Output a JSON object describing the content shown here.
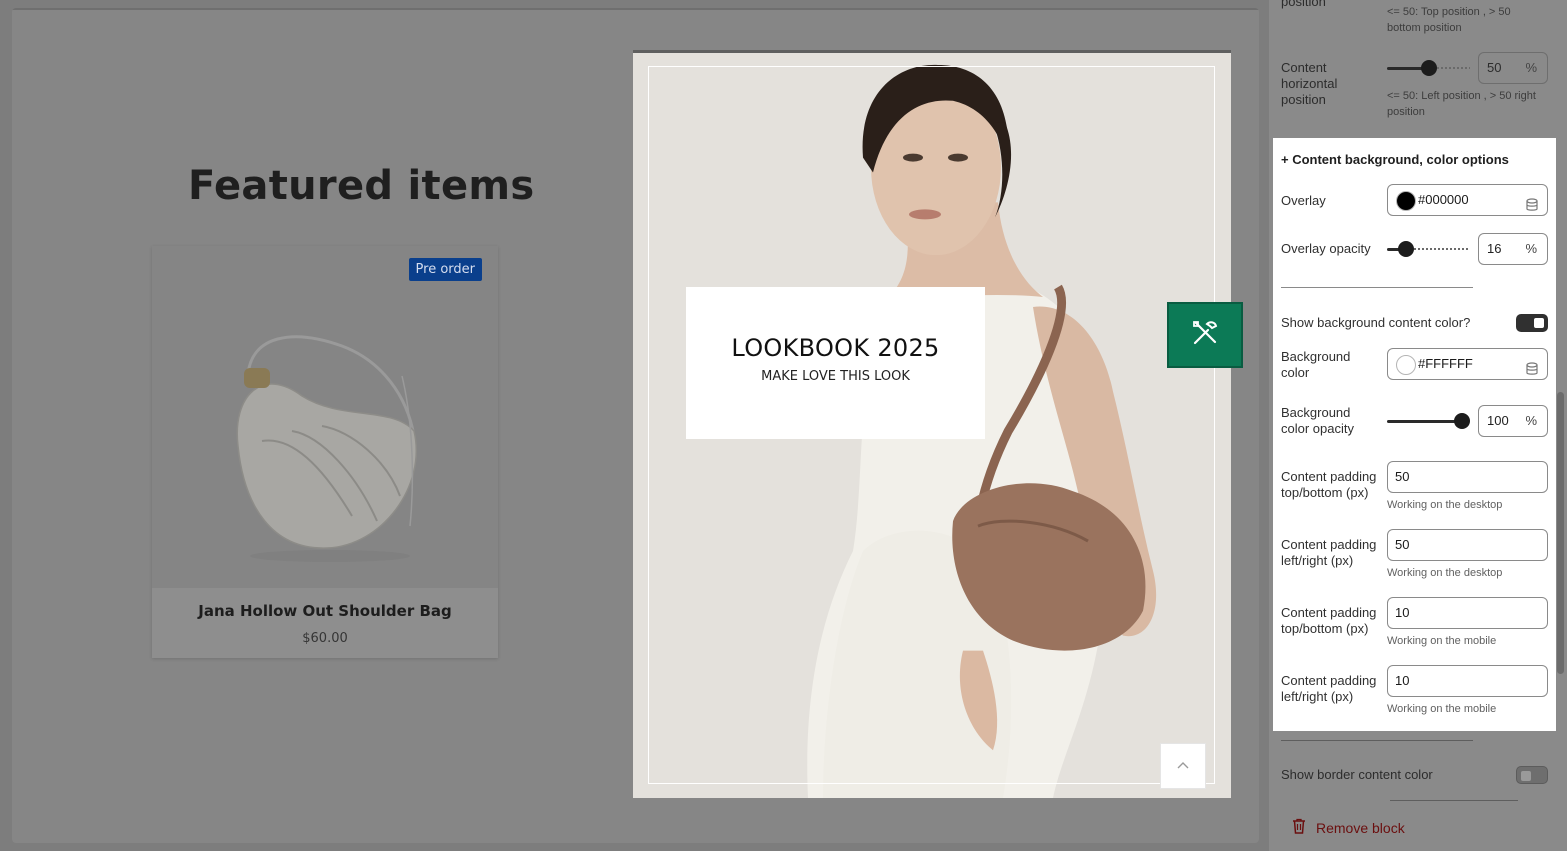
{
  "preview": {
    "featured_title": "Featured items",
    "product": {
      "badge": "Pre order",
      "name": "Jana Hollow Out Shoulder Bag",
      "price": "$60.00"
    },
    "lookbook": {
      "title": "LOOKBOOK 2025",
      "subtitle": "MAKE LOVE THIS LOOK"
    }
  },
  "panel": {
    "top_label": "position",
    "vertical_hint": "<= 50: Top position , > 50 bottom position",
    "horizontal_label": "Content horizontal position",
    "horizontal_value": "50",
    "horizontal_unit": "%",
    "horizontal_level": 0.5,
    "horizontal_hint": "<= 50: Left position , > 50 right position",
    "section_title": "+ Content background, color options",
    "overlay_label": "Overlay",
    "overlay_value": "#000000",
    "overlay_color": "#000000",
    "overlay_opacity_label": "Overlay opacity",
    "overlay_opacity_value": "16",
    "overlay_opacity_unit": "%",
    "overlay_opacity_level": 0.16,
    "show_bg_label": "Show background content color?",
    "show_bg_on": true,
    "bg_color_label": "Background color",
    "bg_color_value": "#FFFFFF",
    "bg_color": "#FFFFFF",
    "bg_opacity_label": "Background color opacity",
    "bg_opacity_value": "100",
    "bg_opacity_unit": "%",
    "bg_opacity_level": 1.0,
    "padding_fields": [
      {
        "label": "Content padding top/bottom (px)",
        "value": "50",
        "hint": "Working on the desktop"
      },
      {
        "label": "Content padding left/right (px)",
        "value": "50",
        "hint": "Working on the desktop"
      },
      {
        "label": "Content padding top/bottom (px)",
        "value": "10",
        "hint": "Working on the mobile"
      },
      {
        "label": "Content padding left/right (px)",
        "value": "10",
        "hint": "Working on the mobile"
      }
    ],
    "show_border_label": "Show border content color",
    "show_border_on": false,
    "remove_block": "Remove block"
  },
  "colors": {
    "accent_green": "#0c7a56",
    "badge_blue": "#0a3f8c",
    "danger": "#8e1b1b"
  }
}
